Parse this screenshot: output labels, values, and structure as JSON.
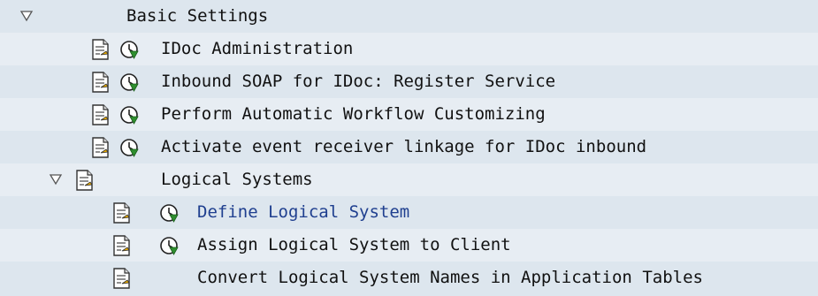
{
  "tree": {
    "items": [
      {
        "label": "Basic Settings",
        "level": 0,
        "expandable": true,
        "expanded": true,
        "has_doc": false,
        "has_exec": false
      },
      {
        "label": "IDoc Administration",
        "level": 1,
        "has_doc": true,
        "has_exec": true
      },
      {
        "label": "Inbound SOAP for IDoc: Register Service",
        "level": 1,
        "has_doc": true,
        "has_exec": true
      },
      {
        "label": "Perform Automatic Workflow Customizing",
        "level": 1,
        "has_doc": true,
        "has_exec": true
      },
      {
        "label": "Activate event receiver linkage for IDoc inbound",
        "level": 1,
        "has_doc": true,
        "has_exec": true
      },
      {
        "label": "Logical Systems",
        "level": 1,
        "expandable": true,
        "expanded": true,
        "has_doc": true,
        "has_exec": false
      },
      {
        "label": "Define Logical System",
        "level": 2,
        "has_doc": true,
        "has_exec": true,
        "highlighted": true
      },
      {
        "label": "Assign Logical System to Client",
        "level": 2,
        "has_doc": true,
        "has_exec": true
      },
      {
        "label": "Convert Logical System Names in Application Tables",
        "level": 2,
        "has_doc": true,
        "has_exec": false
      }
    ]
  },
  "icons": {
    "expander": "triangle-down-icon",
    "doc": "document-icon",
    "exec": "execute-clock-icon"
  },
  "colors": {
    "row_bg": "#dde6ee",
    "highlight_text": "#1f3f8f",
    "icon_green": "#2f8f2f"
  }
}
